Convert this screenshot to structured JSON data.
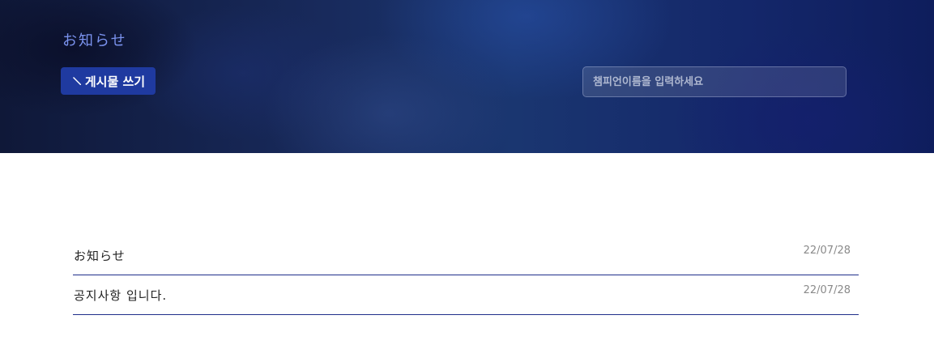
{
  "hero": {
    "title": "お知らせ",
    "write_button_label": "게시물 쓰기",
    "search": {
      "value": "",
      "placeholder": "챔피언이름을 입력하세요"
    }
  },
  "posts": [
    {
      "title": "お知らせ",
      "date": "22/07/28"
    },
    {
      "title": "공지사항 입니다.",
      "date": "22/07/28"
    }
  ],
  "colors": {
    "accent": "#1f3aa0",
    "title_text": "#7b93ef",
    "divider": "#1f2f8a",
    "date_text": "#8a8a8a"
  },
  "icons": {
    "write_button": "pencil-icon"
  }
}
